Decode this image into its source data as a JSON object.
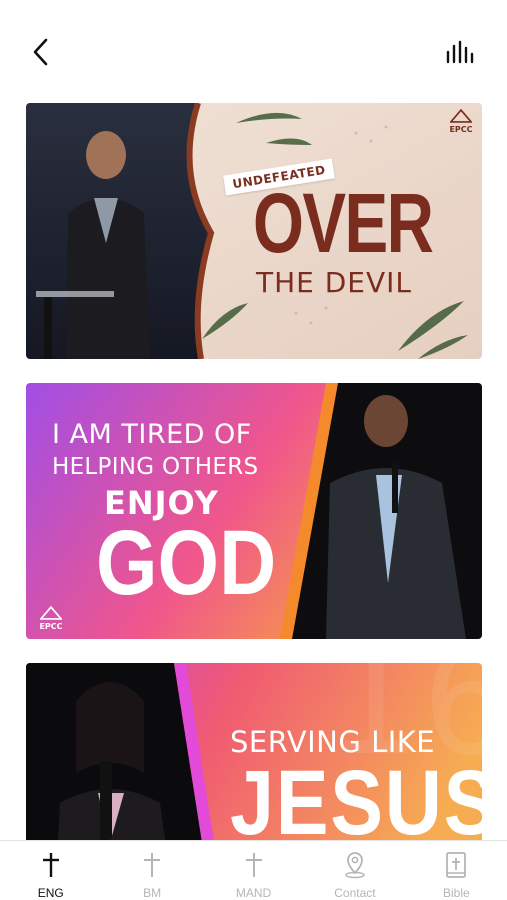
{
  "header": {
    "back_icon": "chevron-left-icon",
    "menu_icon": "equalizer-icon"
  },
  "feed": {
    "cards": [
      {
        "tag": "UNDEFEATED",
        "title": "OVER",
        "subtitle": "THE DEVIL",
        "logo": "EPCC",
        "colors": {
          "bg": "#eddcd0",
          "text": "#7a2d1f"
        }
      },
      {
        "line1": "I AM TIRED OF",
        "line2": "HELPING OTHERS",
        "line3": "ENJOY",
        "line4": "GOD",
        "logo": "EPCC",
        "colors": {
          "start": "#a14ee6",
          "mid": "#f0568c",
          "end": "#f7a93a"
        }
      },
      {
        "line1": "SERVING LIKE",
        "line2": "JESUS",
        "colors": {
          "start": "#c83be8",
          "mid": "#f05b72",
          "end": "#f6ad52"
        }
      }
    ]
  },
  "tabbar": {
    "tabs": [
      {
        "label": "ENG",
        "icon": "cross-icon",
        "active": true
      },
      {
        "label": "BM",
        "icon": "cross-icon",
        "active": false
      },
      {
        "label": "MAND",
        "icon": "cross-icon",
        "active": false
      },
      {
        "label": "Contact",
        "icon": "location-pin-icon",
        "active": false
      },
      {
        "label": "Bible",
        "icon": "bible-icon",
        "active": false
      }
    ],
    "colors": {
      "active": "#111111",
      "inactive": "#b5b5b5"
    }
  }
}
